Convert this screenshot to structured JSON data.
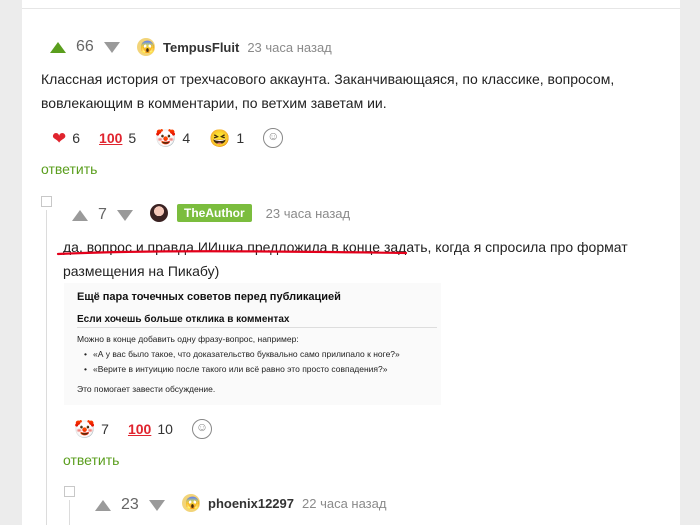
{
  "comments": [
    {
      "votes": "66",
      "username": "TempusFluit",
      "time": "23 часа назад",
      "text_line1": "Классная история от трехчасового аккаунта. Заканчивающаяся, по классике, вопросом,",
      "text_line2": "вовлекающим в комментарии, по ветхим заветам ии.",
      "reactions": [
        {
          "icon": "heart",
          "count": "6"
        },
        {
          "icon": "hundred",
          "count": "5"
        },
        {
          "icon": "clown",
          "count": "4"
        },
        {
          "icon": "laughing-face",
          "count": "1"
        }
      ],
      "reply_label": "ответить"
    },
    {
      "votes": "7",
      "username": "TheAuthor",
      "time": "23 часа назад",
      "text_line1": "да, вопрос и правда ИИшка предложила в конце задать, когда я спросила про формат",
      "text_line2": "размещения на Пикабу)",
      "screenshot": {
        "title": "Ещё пара точечных советов перед публикацией",
        "subtitle": "Если хочешь больше отклика в комментах",
        "intro": "Можно в конце добавить одну фразу-вопрос, например:",
        "bullets": [
          "«А у вас было такое, что доказательство буквально само прилипало к ноге?»",
          "«Верите в интуицию после такого или всё равно это просто совпадения?»"
        ],
        "outro": "Это помогает завести обсуждение."
      },
      "reactions": [
        {
          "icon": "clown",
          "count": "7"
        },
        {
          "icon": "hundred",
          "count": "10"
        }
      ],
      "reply_label": "ответить"
    },
    {
      "votes": "23",
      "username": "phoenix12297",
      "time": "22 часа назад"
    }
  ],
  "colors": {
    "upvote_green": "#5a9e1d",
    "reply_green": "#5a9e1d",
    "author_badge": "#7bbd3e",
    "arrow_gray": "#9a9a9a",
    "underline_red": "#e3001b"
  }
}
